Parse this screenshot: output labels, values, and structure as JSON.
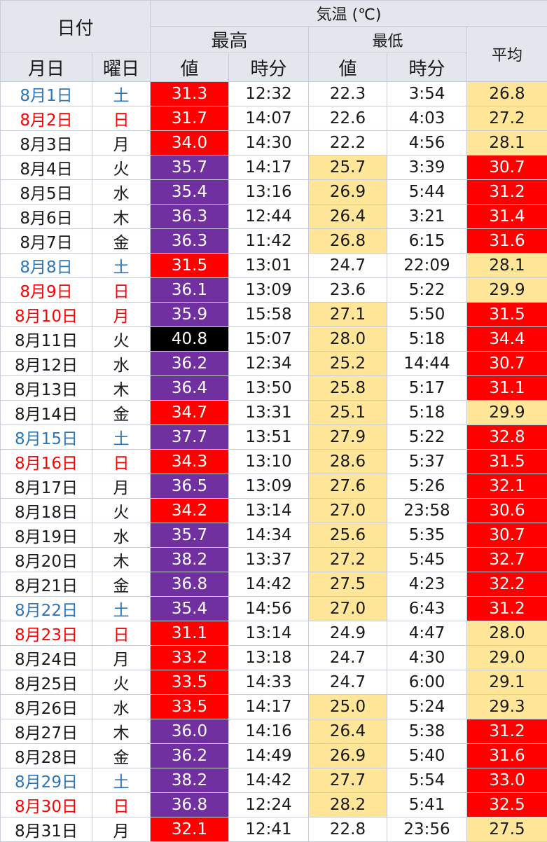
{
  "header": {
    "date_group": "日付",
    "temp_group": "気温 (℃)",
    "max_group": "最高",
    "min_group": "最低",
    "avg": "平均",
    "month_day": "月日",
    "weekday": "曜日",
    "max_value": "値",
    "max_time": "時分",
    "min_value": "値",
    "min_time": "時分"
  },
  "colors": {
    "purple": "#7030a0",
    "red": "#ff0000",
    "black": "#000000",
    "yellow": "#ffe699",
    "saturday_text": "#2e75b6",
    "sunday_text": "#ff0000",
    "header_bg": "#e4e6ee"
  },
  "rows": [
    {
      "date": "8月1日",
      "dow": "土",
      "dtype": "sat",
      "max": "31.3",
      "maxc": "red",
      "maxt": "12:32",
      "min": "22.3",
      "minc": "",
      "mint": "3:54",
      "avg": "26.8",
      "avgc": "yellow"
    },
    {
      "date": "8月2日",
      "dow": "日",
      "dtype": "sun",
      "max": "31.7",
      "maxc": "red",
      "maxt": "14:07",
      "min": "22.6",
      "minc": "",
      "mint": "4:03",
      "avg": "27.2",
      "avgc": "yellow"
    },
    {
      "date": "8月3日",
      "dow": "月",
      "dtype": "",
      "max": "34.0",
      "maxc": "red",
      "maxt": "14:30",
      "min": "22.2",
      "minc": "",
      "mint": "4:56",
      "avg": "28.1",
      "avgc": "yellow"
    },
    {
      "date": "8月4日",
      "dow": "火",
      "dtype": "",
      "max": "35.7",
      "maxc": "purple",
      "maxt": "14:17",
      "min": "25.7",
      "minc": "yellow",
      "mint": "3:39",
      "avg": "30.7",
      "avgc": "red"
    },
    {
      "date": "8月5日",
      "dow": "水",
      "dtype": "",
      "max": "35.4",
      "maxc": "purple",
      "maxt": "13:16",
      "min": "26.9",
      "minc": "yellow",
      "mint": "5:44",
      "avg": "31.2",
      "avgc": "red"
    },
    {
      "date": "8月6日",
      "dow": "木",
      "dtype": "",
      "max": "36.3",
      "maxc": "purple",
      "maxt": "12:44",
      "min": "26.4",
      "minc": "yellow",
      "mint": "3:21",
      "avg": "31.4",
      "avgc": "red"
    },
    {
      "date": "8月7日",
      "dow": "金",
      "dtype": "",
      "max": "36.3",
      "maxc": "purple",
      "maxt": "11:42",
      "min": "26.8",
      "minc": "yellow",
      "mint": "6:15",
      "avg": "31.6",
      "avgc": "red"
    },
    {
      "date": "8月8日",
      "dow": "土",
      "dtype": "sat",
      "max": "31.5",
      "maxc": "red",
      "maxt": "13:01",
      "min": "24.7",
      "minc": "",
      "mint": "22:09",
      "avg": "28.1",
      "avgc": "yellow"
    },
    {
      "date": "8月9日",
      "dow": "日",
      "dtype": "sun",
      "max": "36.1",
      "maxc": "purple",
      "maxt": "13:09",
      "min": "23.6",
      "minc": "",
      "mint": "5:22",
      "avg": "29.9",
      "avgc": "yellow"
    },
    {
      "date": "8月10日",
      "dow": "月",
      "dtype": "sun",
      "max": "35.9",
      "maxc": "purple",
      "maxt": "15:58",
      "min": "27.1",
      "minc": "yellow",
      "mint": "5:50",
      "avg": "31.5",
      "avgc": "red"
    },
    {
      "date": "8月11日",
      "dow": "火",
      "dtype": "",
      "max": "40.8",
      "maxc": "black",
      "maxt": "15:07",
      "min": "28.0",
      "minc": "yellow",
      "mint": "5:18",
      "avg": "34.4",
      "avgc": "red"
    },
    {
      "date": "8月12日",
      "dow": "水",
      "dtype": "",
      "max": "36.2",
      "maxc": "purple",
      "maxt": "12:34",
      "min": "25.2",
      "minc": "yellow",
      "mint": "14:44",
      "avg": "30.7",
      "avgc": "red"
    },
    {
      "date": "8月13日",
      "dow": "木",
      "dtype": "",
      "max": "36.4",
      "maxc": "purple",
      "maxt": "13:50",
      "min": "25.8",
      "minc": "yellow",
      "mint": "5:17",
      "avg": "31.1",
      "avgc": "red"
    },
    {
      "date": "8月14日",
      "dow": "金",
      "dtype": "",
      "max": "34.7",
      "maxc": "red",
      "maxt": "13:31",
      "min": "25.1",
      "minc": "yellow",
      "mint": "5:18",
      "avg": "29.9",
      "avgc": "yellow"
    },
    {
      "date": "8月15日",
      "dow": "土",
      "dtype": "sat",
      "max": "37.7",
      "maxc": "purple",
      "maxt": "13:51",
      "min": "27.9",
      "minc": "yellow",
      "mint": "5:22",
      "avg": "32.8",
      "avgc": "red"
    },
    {
      "date": "8月16日",
      "dow": "日",
      "dtype": "sun",
      "max": "34.3",
      "maxc": "red",
      "maxt": "13:10",
      "min": "28.6",
      "minc": "yellow",
      "mint": "5:37",
      "avg": "31.5",
      "avgc": "red"
    },
    {
      "date": "8月17日",
      "dow": "月",
      "dtype": "",
      "max": "36.5",
      "maxc": "purple",
      "maxt": "13:09",
      "min": "27.6",
      "minc": "yellow",
      "mint": "5:26",
      "avg": "32.1",
      "avgc": "red"
    },
    {
      "date": "8月18日",
      "dow": "火",
      "dtype": "",
      "max": "34.2",
      "maxc": "red",
      "maxt": "13:14",
      "min": "27.0",
      "minc": "yellow",
      "mint": "23:58",
      "avg": "30.6",
      "avgc": "red"
    },
    {
      "date": "8月19日",
      "dow": "水",
      "dtype": "",
      "max": "35.7",
      "maxc": "purple",
      "maxt": "14:34",
      "min": "25.6",
      "minc": "yellow",
      "mint": "5:35",
      "avg": "30.7",
      "avgc": "red"
    },
    {
      "date": "8月20日",
      "dow": "木",
      "dtype": "",
      "max": "38.2",
      "maxc": "purple",
      "maxt": "13:37",
      "min": "27.2",
      "minc": "yellow",
      "mint": "5:45",
      "avg": "32.7",
      "avgc": "red"
    },
    {
      "date": "8月21日",
      "dow": "金",
      "dtype": "",
      "max": "36.8",
      "maxc": "purple",
      "maxt": "14:42",
      "min": "27.5",
      "minc": "yellow",
      "mint": "4:23",
      "avg": "32.2",
      "avgc": "red"
    },
    {
      "date": "8月22日",
      "dow": "土",
      "dtype": "sat",
      "max": "35.4",
      "maxc": "purple",
      "maxt": "14:56",
      "min": "27.0",
      "minc": "yellow",
      "mint": "6:43",
      "avg": "31.2",
      "avgc": "red"
    },
    {
      "date": "8月23日",
      "dow": "日",
      "dtype": "sun",
      "max": "31.1",
      "maxc": "red",
      "maxt": "13:14",
      "min": "24.9",
      "minc": "",
      "mint": "4:47",
      "avg": "28.0",
      "avgc": "yellow"
    },
    {
      "date": "8月24日",
      "dow": "月",
      "dtype": "",
      "max": "33.2",
      "maxc": "red",
      "maxt": "13:18",
      "min": "24.7",
      "minc": "",
      "mint": "4:30",
      "avg": "29.0",
      "avgc": "yellow"
    },
    {
      "date": "8月25日",
      "dow": "火",
      "dtype": "",
      "max": "33.5",
      "maxc": "red",
      "maxt": "14:33",
      "min": "24.7",
      "minc": "",
      "mint": "6:00",
      "avg": "29.1",
      "avgc": "yellow"
    },
    {
      "date": "8月26日",
      "dow": "水",
      "dtype": "",
      "max": "33.5",
      "maxc": "red",
      "maxt": "14:17",
      "min": "25.0",
      "minc": "yellow",
      "mint": "5:24",
      "avg": "29.3",
      "avgc": "yellow"
    },
    {
      "date": "8月27日",
      "dow": "木",
      "dtype": "",
      "max": "36.0",
      "maxc": "purple",
      "maxt": "14:16",
      "min": "26.4",
      "minc": "yellow",
      "mint": "5:38",
      "avg": "31.2",
      "avgc": "red"
    },
    {
      "date": "8月28日",
      "dow": "金",
      "dtype": "",
      "max": "36.2",
      "maxc": "purple",
      "maxt": "14:49",
      "min": "26.9",
      "minc": "yellow",
      "mint": "5:40",
      "avg": "31.6",
      "avgc": "red"
    },
    {
      "date": "8月29日",
      "dow": "土",
      "dtype": "sat",
      "max": "38.2",
      "maxc": "purple",
      "maxt": "14:42",
      "min": "27.7",
      "minc": "yellow",
      "mint": "5:54",
      "avg": "33.0",
      "avgc": "red"
    },
    {
      "date": "8月30日",
      "dow": "日",
      "dtype": "sun",
      "max": "36.8",
      "maxc": "purple",
      "maxt": "12:24",
      "min": "28.2",
      "minc": "yellow",
      "mint": "5:41",
      "avg": "32.5",
      "avgc": "red"
    },
    {
      "date": "8月31日",
      "dow": "月",
      "dtype": "",
      "max": "32.1",
      "maxc": "red",
      "maxt": "12:41",
      "min": "22.8",
      "minc": "",
      "mint": "23:56",
      "avg": "27.5",
      "avgc": "yellow"
    }
  ]
}
